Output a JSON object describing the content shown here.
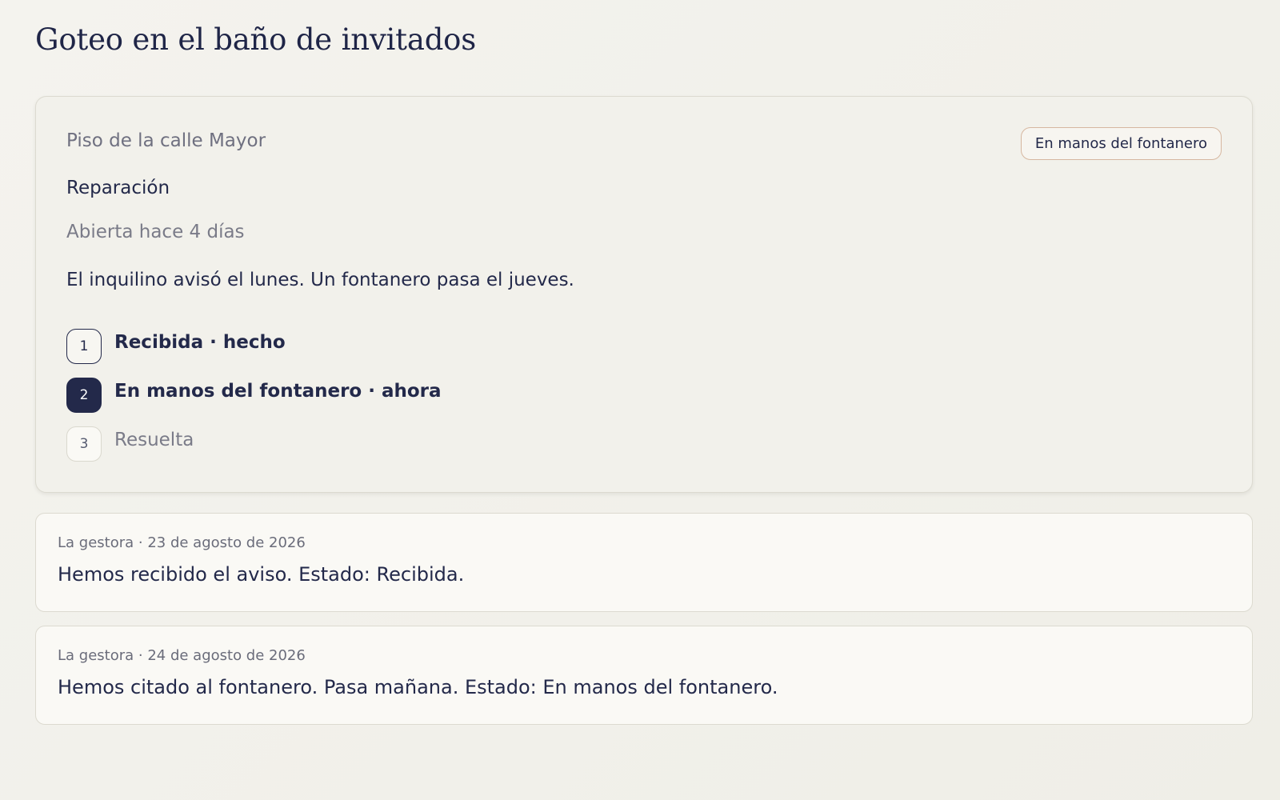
{
  "page": {
    "title": "Goteo en el baño de invitados"
  },
  "ticket": {
    "property": "Piso de la calle Mayor",
    "status_badge": "En manos del fontanero",
    "category": "Reparación",
    "opened": "Abierta hace 4 días",
    "description": "El inquilino avisó el lunes. Un fontanero pasa el jueves.",
    "steps": [
      {
        "number": "1",
        "label": "Recibida · hecho",
        "state": "done"
      },
      {
        "number": "2",
        "label": "En manos del fontanero · ahora",
        "state": "current"
      },
      {
        "number": "3",
        "label": "Resuelta",
        "state": "pending"
      }
    ]
  },
  "updates": [
    {
      "meta": "La gestora · 23 de agosto de 2026",
      "text": "Hemos recibido el aviso. Estado: Recibida."
    },
    {
      "meta": "La gestora · 24 de agosto de 2026",
      "text": "Hemos citado al fontanero. Pasa mañana. Estado: En manos del fontanero."
    }
  ],
  "colors": {
    "accent": "#23294a",
    "badge_border": "#d6b7a0",
    "background": "#f2f1eb"
  }
}
